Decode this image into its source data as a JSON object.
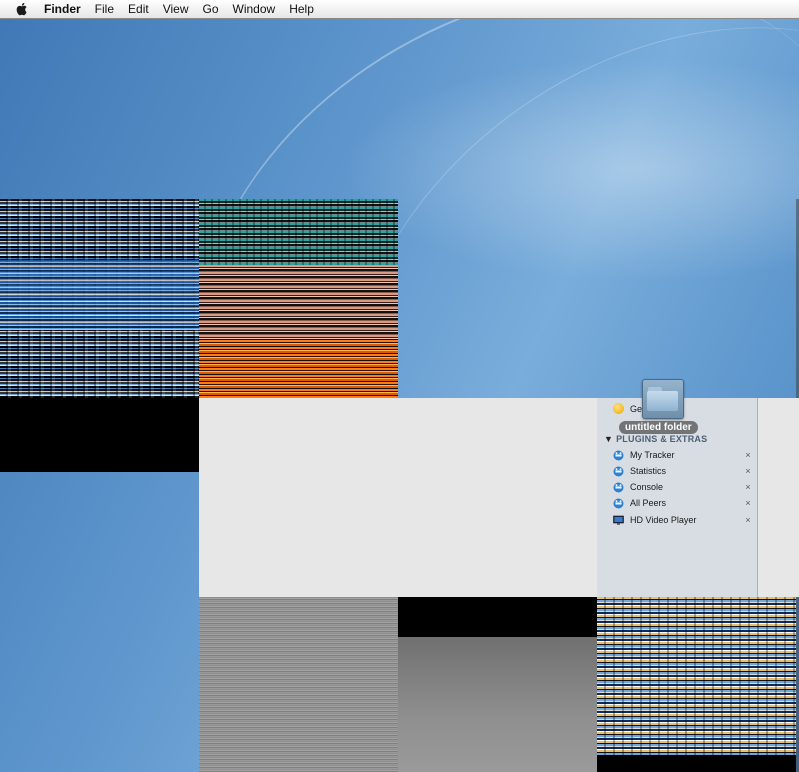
{
  "menubar": {
    "apple_icon": "apple-icon",
    "app_name": "Finder",
    "items": [
      "File",
      "Edit",
      "View",
      "Go",
      "Window",
      "Help"
    ]
  },
  "desktop": {
    "folder_label": "untitled folder"
  },
  "sidebar": {
    "top_item": "Ge",
    "section_title": "PLUGINS & EXTRAS",
    "items": [
      {
        "label": "My Tracker",
        "icon": "plugin-icon",
        "close": "×"
      },
      {
        "label": "Statistics",
        "icon": "plugin-icon",
        "close": "×"
      },
      {
        "label": "Console",
        "icon": "plugin-icon",
        "close": "×"
      },
      {
        "label": "All Peers",
        "icon": "plugin-icon",
        "close": "×"
      },
      {
        "label": "HD Video Player",
        "icon": "monitor-icon",
        "close": "×"
      }
    ]
  },
  "colors": {
    "sidebar_bg": "#d7dde3",
    "section_head": "#4e5f73",
    "plugin_icon": "#2f7fd6"
  }
}
